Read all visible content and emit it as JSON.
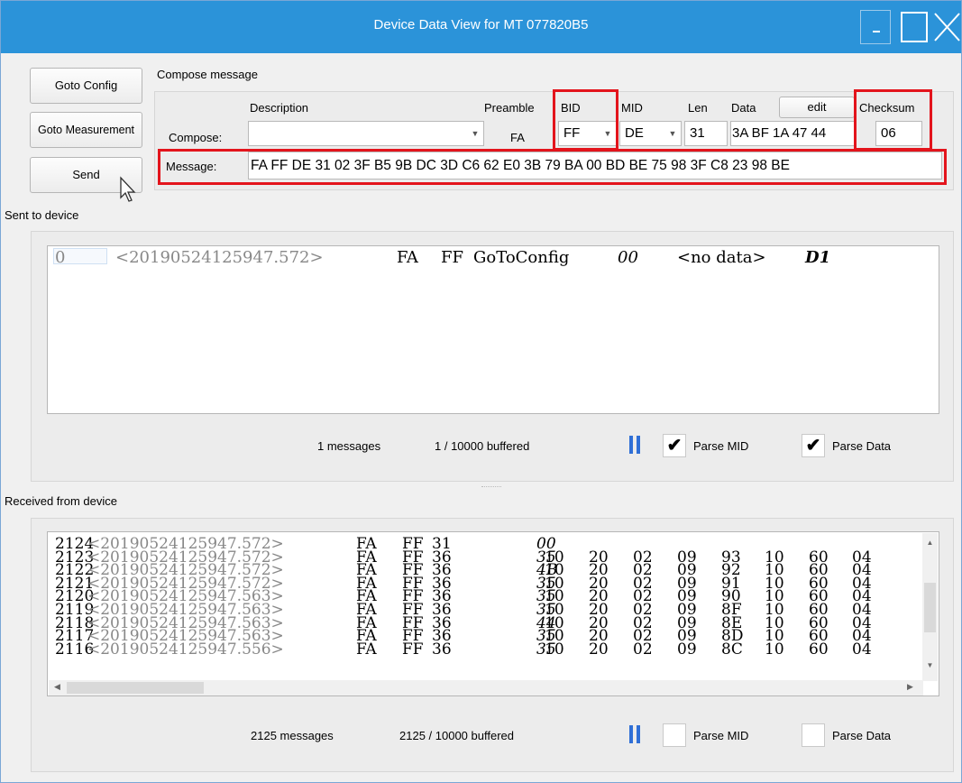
{
  "window": {
    "title": "Device Data View for MT 077820B5"
  },
  "left_buttons": {
    "goto_config": "Goto Config",
    "goto_measurement": "Goto Measurement",
    "send": "Send"
  },
  "compose": {
    "group_label": "Compose message",
    "row_label": "Compose:",
    "message_label": "Message:",
    "headers": {
      "description": "Description",
      "preamble": "Preamble",
      "bid": "BID",
      "mid": "MID",
      "len": "Len",
      "data": "Data",
      "edit": "edit",
      "checksum": "Checksum"
    },
    "description_value": "",
    "preamble_value": "FA",
    "bid_value": "FF",
    "mid_value": "DE",
    "len_value": "31",
    "data_value": "3A BF 1A 47 44",
    "checksum_value": "06",
    "message_value": "FA FF DE 31 02 3F B5 9B DC 3D C6 62 E0 3B 79 BA 00 BD BE 75 98 3F C8 23 98 BE"
  },
  "sent": {
    "label": "Sent to device",
    "row": {
      "index": "0",
      "timestamp": "<20190524125947.572>",
      "preamble": "FA",
      "bid": "FF",
      "mid": "GoToConfig",
      "len": "00",
      "data": "<no data>",
      "checksum": "D1"
    },
    "messages": "1 messages",
    "buffered": "1 / 10000 buffered",
    "parse_mid_label": "Parse MID",
    "parse_data_label": "Parse Data",
    "parse_mid_checked": true,
    "parse_data_checked": true
  },
  "received": {
    "label": "Received from device",
    "rows": [
      {
        "index": "2124",
        "timestamp": "<20190524125947.572>",
        "preamble": "FA",
        "bid": "FF",
        "mid": "31",
        "len": "00",
        "data": []
      },
      {
        "index": "2123",
        "timestamp": "<20190524125947.572>",
        "preamble": "FA",
        "bid": "FF",
        "mid": "36",
        "len": "35",
        "data": [
          "10",
          "20",
          "02",
          "09",
          "93",
          "10",
          "60",
          "04"
        ]
      },
      {
        "index": "2122",
        "timestamp": "<20190524125947.572>",
        "preamble": "FA",
        "bid": "FF",
        "mid": "36",
        "len": "4B",
        "data": [
          "10",
          "20",
          "02",
          "09",
          "92",
          "10",
          "60",
          "04"
        ]
      },
      {
        "index": "2121",
        "timestamp": "<20190524125947.572>",
        "preamble": "FA",
        "bid": "FF",
        "mid": "36",
        "len": "35",
        "data": [
          "10",
          "20",
          "02",
          "09",
          "91",
          "10",
          "60",
          "04"
        ]
      },
      {
        "index": "2120",
        "timestamp": "<20190524125947.563>",
        "preamble": "FA",
        "bid": "FF",
        "mid": "36",
        "len": "35",
        "data": [
          "10",
          "20",
          "02",
          "09",
          "90",
          "10",
          "60",
          "04"
        ]
      },
      {
        "index": "2119",
        "timestamp": "<20190524125947.563>",
        "preamble": "FA",
        "bid": "FF",
        "mid": "36",
        "len": "35",
        "data": [
          "10",
          "20",
          "02",
          "09",
          "8F",
          "10",
          "60",
          "04"
        ]
      },
      {
        "index": "2118",
        "timestamp": "<20190524125947.563>",
        "preamble": "FA",
        "bid": "FF",
        "mid": "36",
        "len": "44",
        "data": [
          "10",
          "20",
          "02",
          "09",
          "8E",
          "10",
          "60",
          "04"
        ]
      },
      {
        "index": "2117",
        "timestamp": "<20190524125947.563>",
        "preamble": "FA",
        "bid": "FF",
        "mid": "36",
        "len": "35",
        "data": [
          "10",
          "20",
          "02",
          "09",
          "8D",
          "10",
          "60",
          "04"
        ]
      },
      {
        "index": "2116",
        "timestamp": "<20190524125947.556>",
        "preamble": "FA",
        "bid": "FF",
        "mid": "36",
        "len": "35",
        "data": [
          "10",
          "20",
          "02",
          "09",
          "8C",
          "10",
          "60",
          "04"
        ]
      }
    ],
    "messages": "2125 messages",
    "buffered": "2125 / 10000 buffered",
    "parse_mid_label": "Parse MID",
    "parse_data_label": "Parse Data",
    "parse_mid_checked": false,
    "parse_data_checked": false
  },
  "icons": {
    "pause": "pause-icon",
    "check": "✔",
    "minimize": "minimize-icon",
    "maximize": "maximize-icon",
    "close": "close-icon"
  }
}
